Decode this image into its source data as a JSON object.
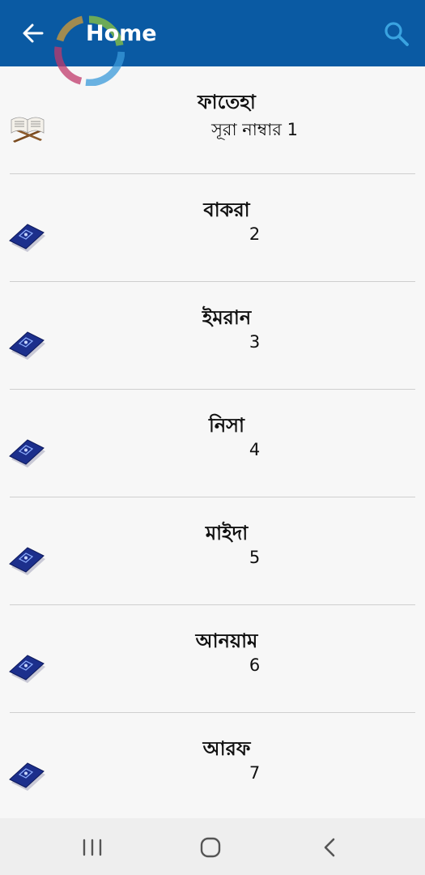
{
  "appbar": {
    "title": "Home",
    "background_color": "#0a5aa3",
    "back_icon": "arrow-left-icon",
    "search_icon": "search-icon",
    "search_icon_color": "#3aa3e0"
  },
  "surahs": [
    {
      "name": "ফাতেহা",
      "number_text": "সূরা নাম্বার 1",
      "icon": "open-quran-on-stand-icon"
    },
    {
      "name": "বাকরা",
      "number_text": "2",
      "icon": "quran-book-icon"
    },
    {
      "name": "ইমরান",
      "number_text": "3",
      "icon": "quran-book-icon"
    },
    {
      "name": "নিসা",
      "number_text": "4",
      "icon": "quran-book-icon"
    },
    {
      "name": "মাইদা",
      "number_text": "5",
      "icon": "quran-book-icon"
    },
    {
      "name": "আনয়াম",
      "number_text": "6",
      "icon": "quran-book-icon"
    },
    {
      "name": "আরফ",
      "number_text": "7",
      "icon": "quran-book-icon"
    }
  ],
  "navbar": {
    "recents_icon": "recents-icon",
    "home_icon": "home-circle-icon",
    "back_icon": "chevron-left-icon"
  }
}
